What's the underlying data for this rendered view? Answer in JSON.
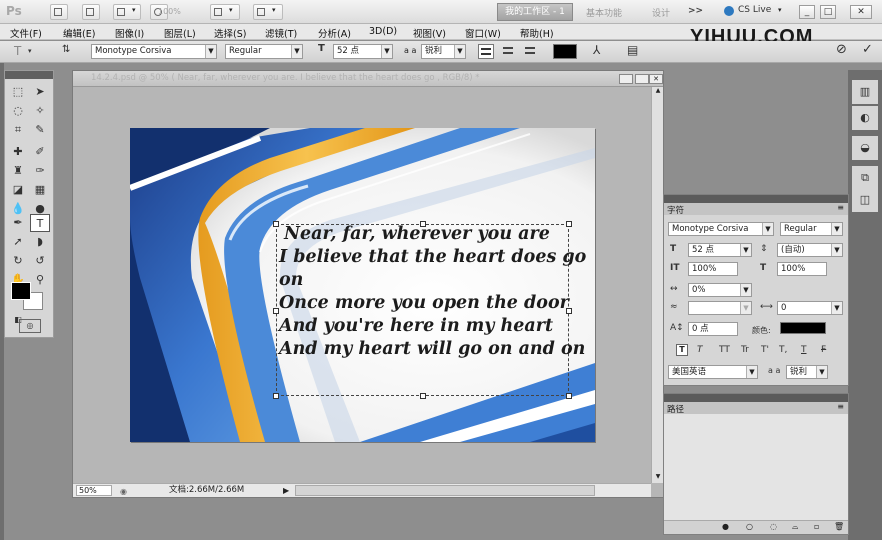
{
  "app": {
    "logo": "Ps",
    "zoom_readout": "100%",
    "workspace_active": "我的工作区 - 1",
    "workspace_basic": "基本功能",
    "workspace_design": "设计",
    "more": ">>",
    "cs_live": "CS Live",
    "minimize": "_",
    "restore": "□",
    "close": "✕"
  },
  "menu": {
    "items": [
      "文件(F)",
      "编辑(E)",
      "图像(I)",
      "图层(L)",
      "选择(S)",
      "滤镜(T)",
      "分析(A)",
      "3D(D)",
      "视图(V)",
      "窗口(W)",
      "帮助(H)"
    ]
  },
  "watermark": "YIHUU.COM",
  "options": {
    "font_family": "Monotype Corsiva",
    "font_style": "Regular",
    "font_size": "52 点",
    "antialias_label": "a a",
    "antialias": "锐利"
  },
  "document": {
    "title": "14.2.4.psd @ 50% ( Near, far, wherever you are. I believe that the heart does go , RGB/8) *",
    "zoom": "50%",
    "doc_size": "文档:2.66M/2.66M",
    "text_lines": [
      "Near, far, wherever you are",
      "I believe that the heart does go",
      "on",
      "Once more you open the door",
      "And you're here in my heart",
      "And my heart will go on and on"
    ]
  },
  "character_panel": {
    "tab": "字符",
    "font_family": "Monotype Corsiva",
    "font_style": "Regular",
    "font_size": "52 点",
    "leading": "(自动)",
    "vertical_scale": "100%",
    "horizontal_scale": "100%",
    "tracking": "0%",
    "kerning_value": "0",
    "baseline_shift": "0 点",
    "color_label": "颜色:",
    "type_style_buttons": [
      "T",
      "T",
      "TT",
      "Tr",
      "T'",
      "T,",
      "T",
      "F"
    ],
    "language": "美国英语",
    "antialias_label": "a a",
    "antialias": "锐利"
  },
  "paths_panel": {
    "tab": "路径"
  },
  "colors": {
    "foreground": "#000000",
    "background": "#ffffff",
    "text_color": "#000000"
  }
}
